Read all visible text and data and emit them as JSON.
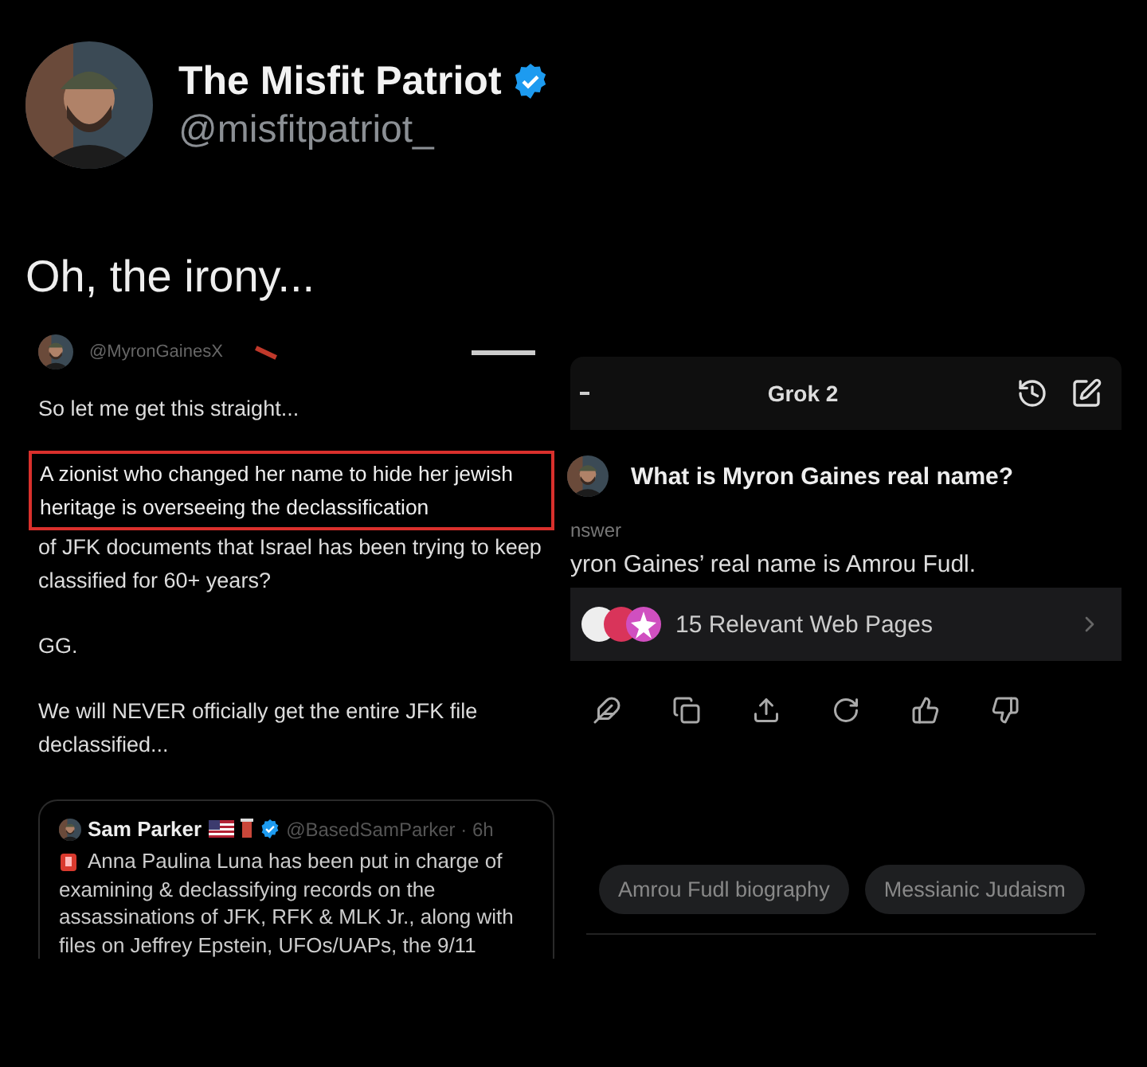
{
  "post": {
    "author": {
      "name": "The Misfit Patriot",
      "handle": "@misfitpatriot_",
      "verified": true
    },
    "text": "Oh, the irony..."
  },
  "quoted_screenshot": {
    "handle": "@MyronGainesX",
    "paragraphs": [
      {
        "kind": "plain",
        "text": "So let me get this straight..."
      },
      {
        "kind": "highlighted",
        "text": "A zionist who changed her name to hide her jewish heritage is overseeing the declassification"
      },
      {
        "kind": "continuation",
        "text": "of JFK documents that Israel has been trying to keep classified for 60+ years?"
      },
      {
        "kind": "plain",
        "text": "GG."
      },
      {
        "kind": "plain",
        "text": "We will NEVER officially get the entire JFK file declassified..."
      }
    ],
    "quote": {
      "name": "Sam Parker",
      "verified": true,
      "handle_time": "@BasedSamParker · 6h",
      "text": "Anna Paulina Luna has been put in charge of examining & declassifying records on the assassinations of JFK, RFK & MLK Jr., along with files on Jeffrey Epstein, UFOs/UAPs, the 9/11"
    }
  },
  "grok_screenshot": {
    "title": "Grok 2",
    "question": "What is Myron Gaines real name?",
    "answer_label": "nswer",
    "answer": "yron Gaines’ real name is Amrou Fudl.",
    "sources": "15 Relevant Web Pages",
    "suggestions": [
      "Amrou Fudl biography",
      "Messianic Judaism"
    ]
  }
}
